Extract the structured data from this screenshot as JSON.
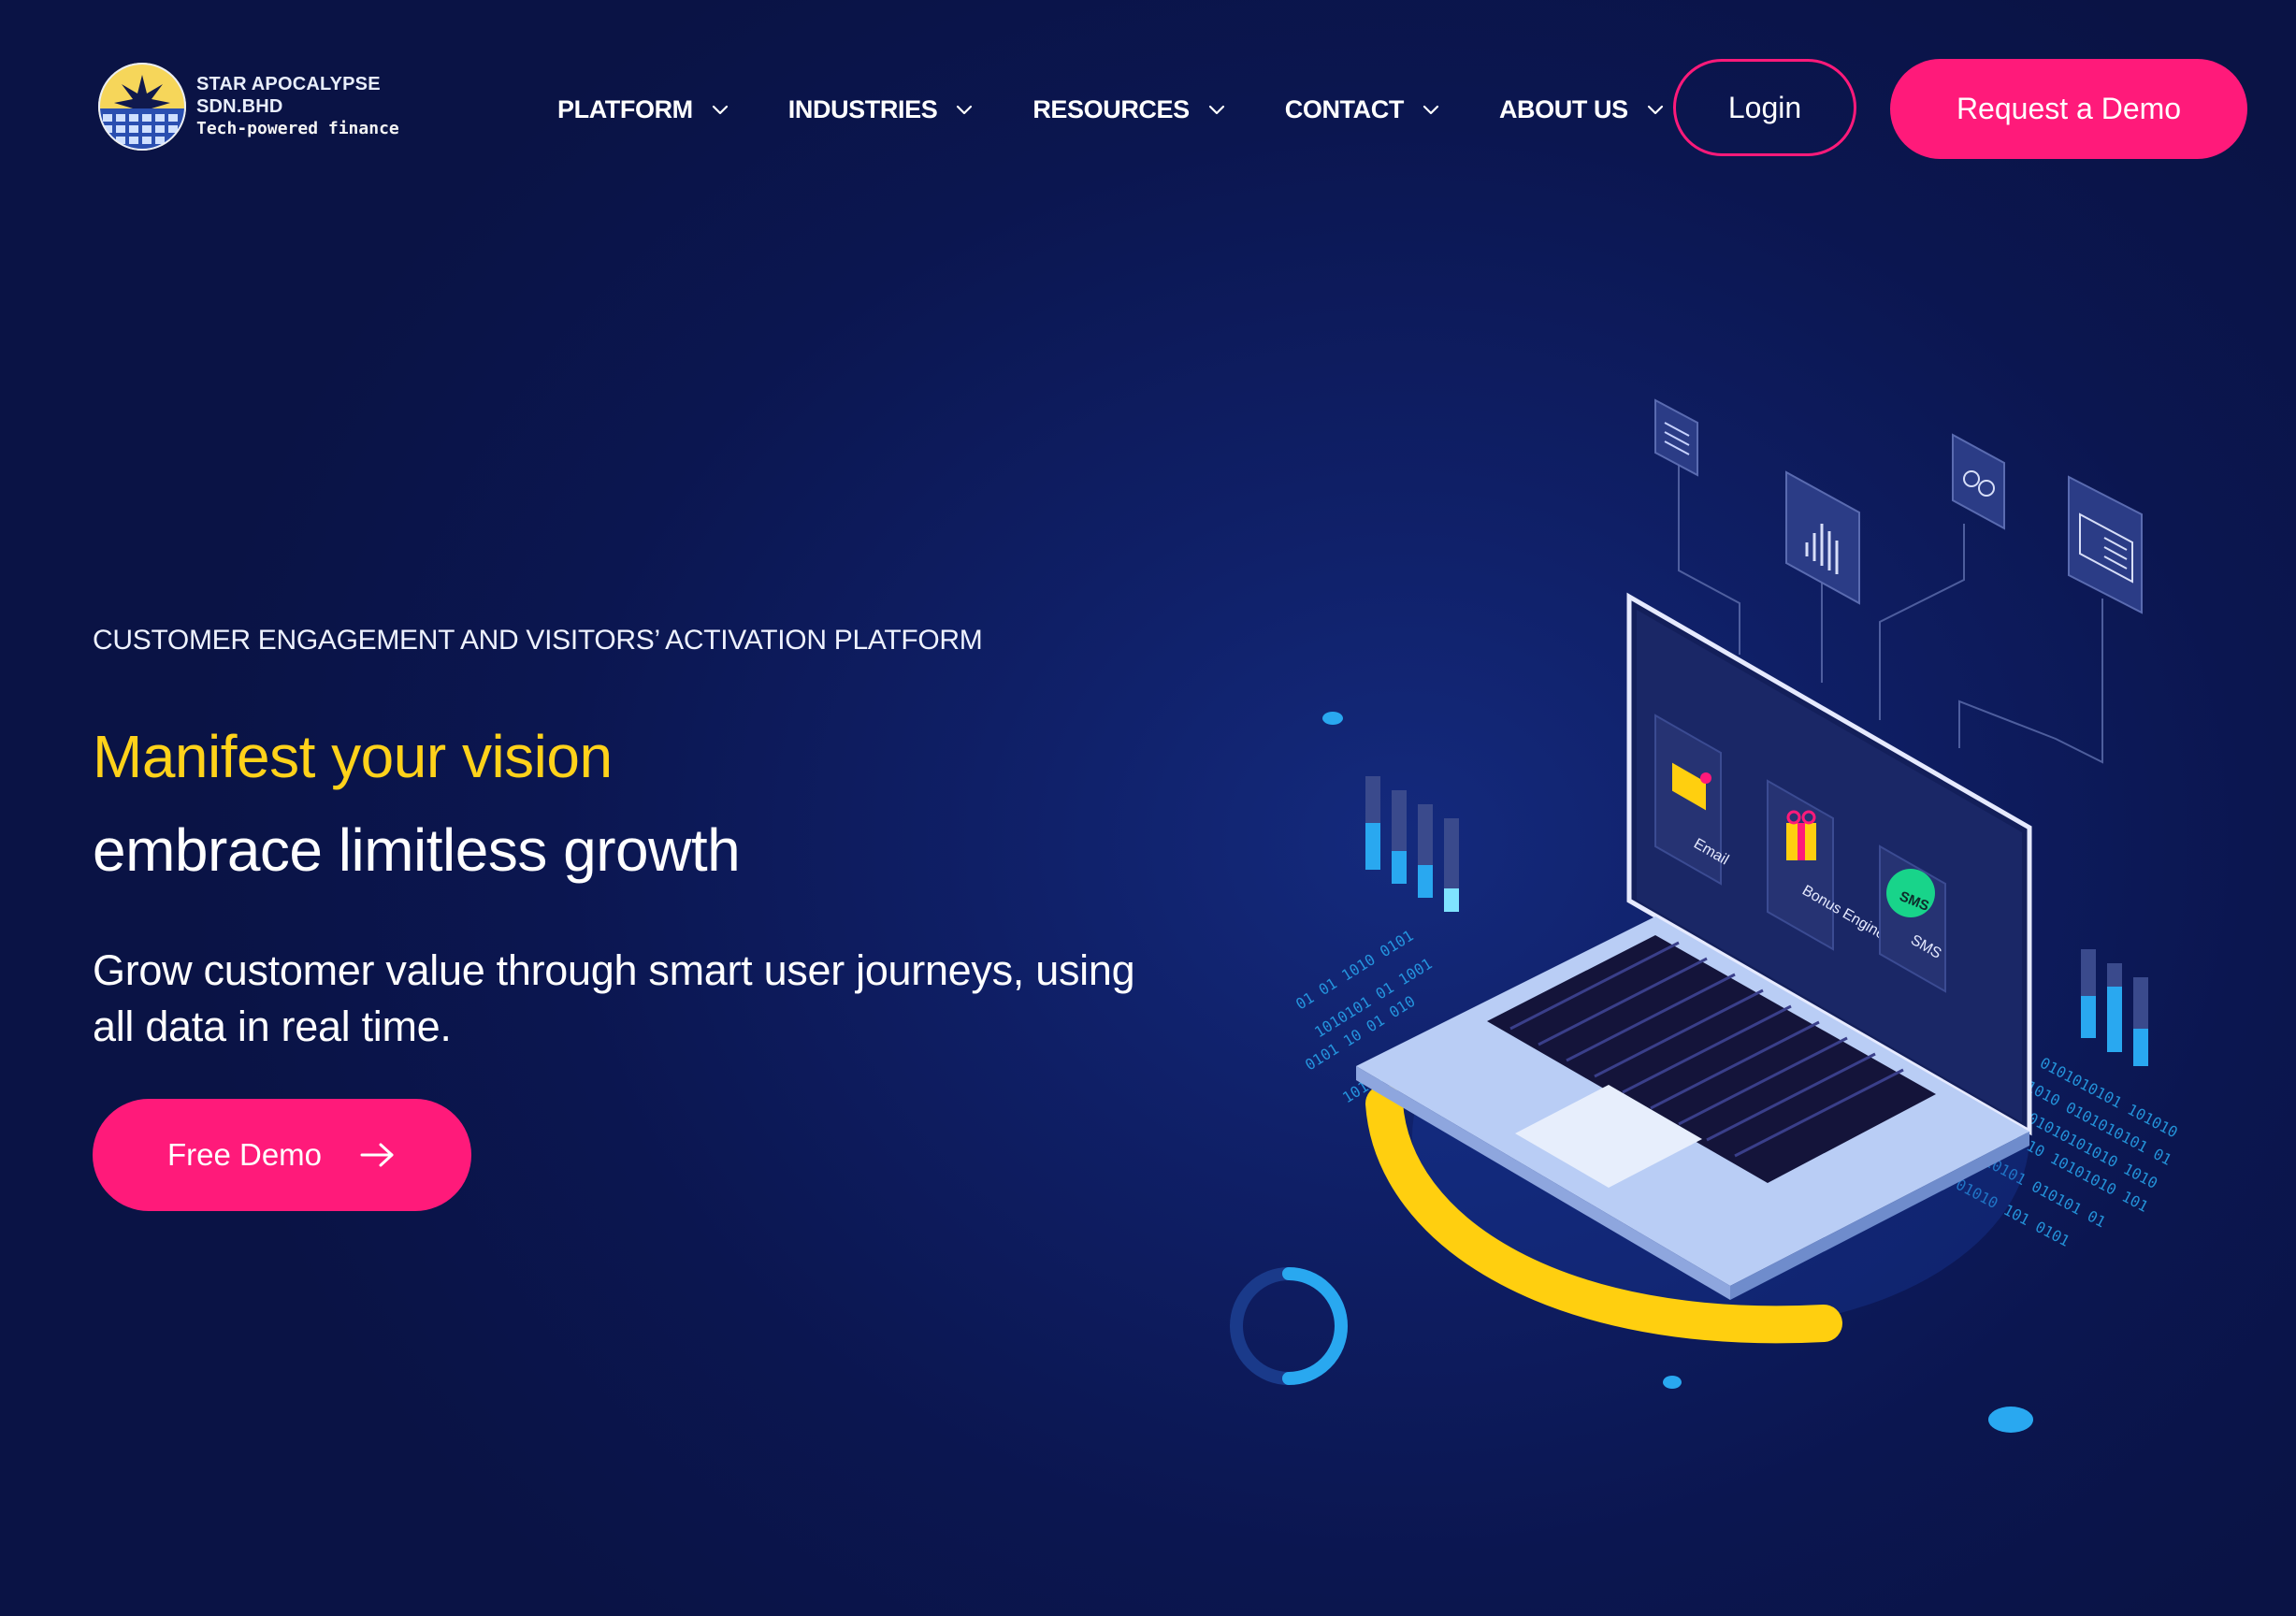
{
  "header": {
    "logo": {
      "name": "STAR APOCALYPSE SDN.BHD",
      "tagline": "Tech-powered finance"
    },
    "nav": [
      {
        "label": "PLATFORM",
        "icon": "chevron-down-icon"
      },
      {
        "label": "INDUSTRIES",
        "icon": "chevron-down-icon"
      },
      {
        "label": "RESOURCES",
        "icon": "chevron-down-icon"
      },
      {
        "label": "CONTACT",
        "icon": "chevron-down-icon"
      },
      {
        "label": "ABOUT US",
        "icon": "chevron-down-icon"
      }
    ],
    "login_label": "Login",
    "demo_label": "Request a Demo"
  },
  "hero": {
    "eyebrow": "CUSTOMER ENGAGEMENT AND VISITORS’ ACTIVATION PLATFORM",
    "headline_accent": "Manifest your vision",
    "headline_main": "embrace limitless growth",
    "description": "Grow customer value through smart user journeys, using all data in real time.",
    "cta_label": "Free Demo",
    "cta_icon": "arrow-right-icon"
  },
  "illustration": {
    "screen_tiles": [
      {
        "label": "Email",
        "icon": "email-icon"
      },
      {
        "label": "Bonus Engine",
        "icon": "gift-icon"
      },
      {
        "label": "SMS",
        "icon": "sms-icon"
      }
    ],
    "sms_badge": "SMS",
    "floating_icons": [
      "document-icon",
      "audio-bars-icon",
      "settings-icon",
      "id-card-icon"
    ]
  },
  "colors": {
    "background": "#0b1650",
    "accent_pink": "#ff1a7a",
    "accent_yellow": "#ffd21a",
    "accent_blue": "#29a8f0"
  }
}
